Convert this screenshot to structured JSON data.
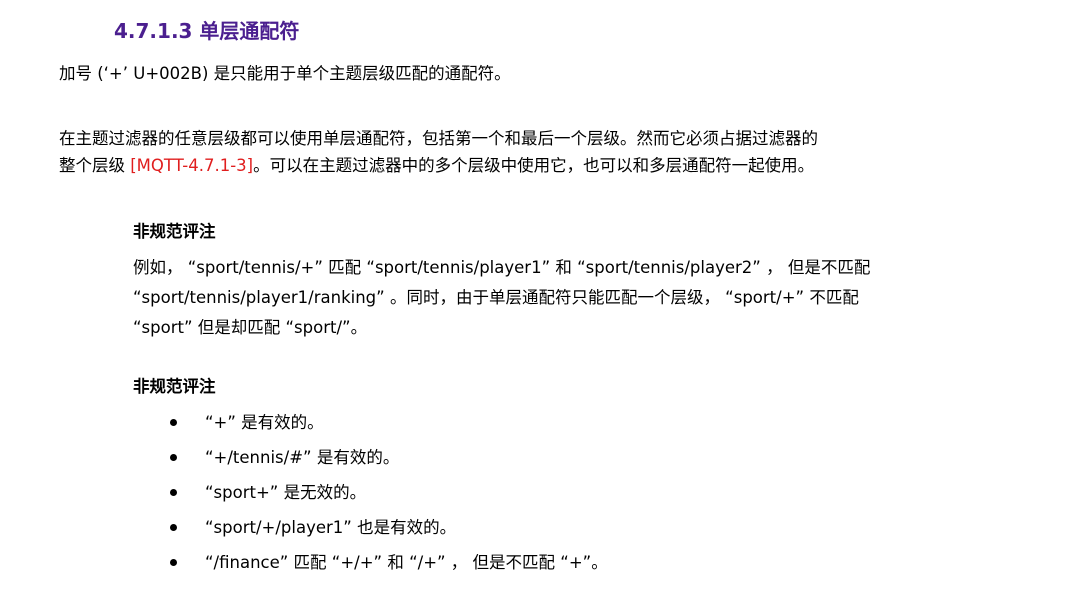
{
  "heading": "4.7.1.3 单层通配符",
  "para1": "加号 (‘+’ U+002B) 是只能用于单个主题层级匹配的通配符。",
  "para2": {
    "line1": "在主题过滤器的任意层级都可以使用单层通配符，包括第一个和最后一个层级。然而它必须占据过滤器的",
    "line2_pre": "整个层级 ",
    "line2_ref": "[MQTT-4.7.1-3]",
    "line2_post": "。可以在主题过滤器中的多个层级中使用它，也可以和多层通配符一起使用。"
  },
  "note1": {
    "title": "非规范评注",
    "lines": [
      "例如， “sport/tennis/+” 匹配 “sport/tennis/player1” 和 “sport/tennis/player2” ， 但是不匹配",
      "“sport/tennis/player1/ranking” 。同时，由于单层通配符只能匹配一个层级， “sport/+” 不匹配",
      "“sport” 但是却匹配 “sport/”。"
    ]
  },
  "note2": {
    "title": "非规范评注",
    "items": [
      "“+” 是有效的。",
      "“+/tennis/#” 是有效的。",
      "“sport+” 是无效的。",
      "“sport/+/player1” 也是有效的。",
      "“/finance” 匹配 “+/+” 和 “/+” ， 但是不匹配 “+”。"
    ]
  },
  "colors": {
    "heading": "#4b1f8f",
    "reference": "#e01e1e"
  }
}
